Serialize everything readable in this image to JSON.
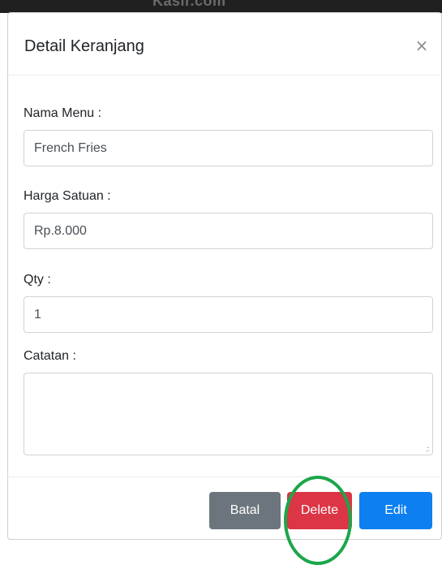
{
  "top_strip": {
    "text": "Kasir.com"
  },
  "modal": {
    "title": "Detail Keranjang",
    "close_label": "×",
    "fields": {
      "nama_menu": {
        "label": "Nama Menu :",
        "value": "French Fries"
      },
      "harga_satuan": {
        "label": "Harga Satuan :",
        "value": "Rp.8.000"
      },
      "qty": {
        "label": "Qty :",
        "value": "1"
      },
      "catatan": {
        "label": "Catatan :",
        "value": ""
      }
    },
    "buttons": {
      "batal": "Batal",
      "delete": "Delete",
      "edit": "Edit"
    }
  },
  "colors": {
    "batal": "#6c757d",
    "delete": "#dc3545",
    "edit": "#0d7ff0",
    "highlight": "#1aa64a"
  }
}
